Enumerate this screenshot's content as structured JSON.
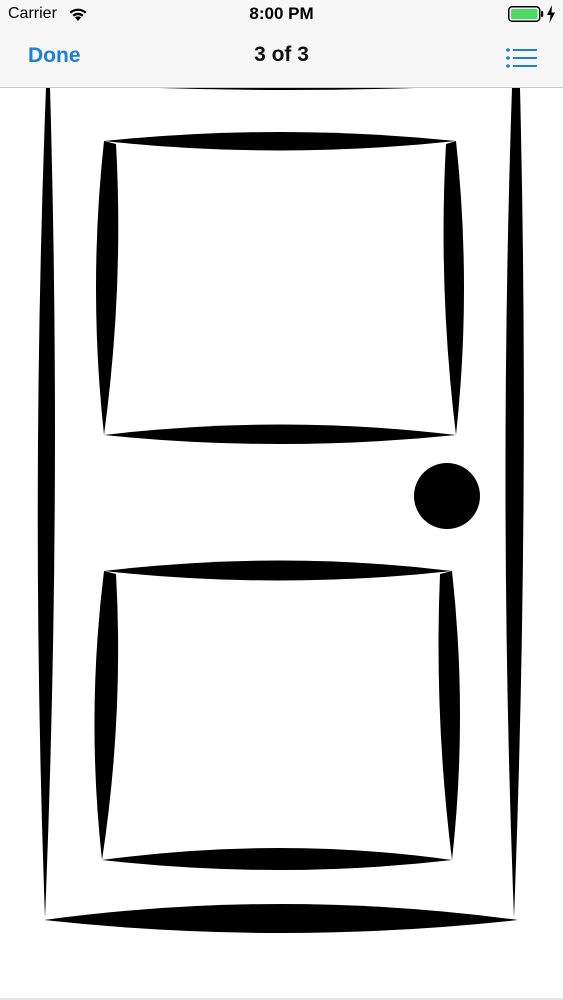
{
  "status_bar": {
    "carrier": "Carrier",
    "time": "8:00 PM",
    "icons": [
      "wifi-icon",
      "battery-icon",
      "charging-icon"
    ],
    "battery_color": "#4cd964"
  },
  "nav_bar": {
    "done_label": "Done",
    "title": "3 of 3",
    "list_icon": "list-icon",
    "accent_color": "#1e7fd6"
  },
  "content": {
    "image_description_icon": "door-drawing"
  }
}
